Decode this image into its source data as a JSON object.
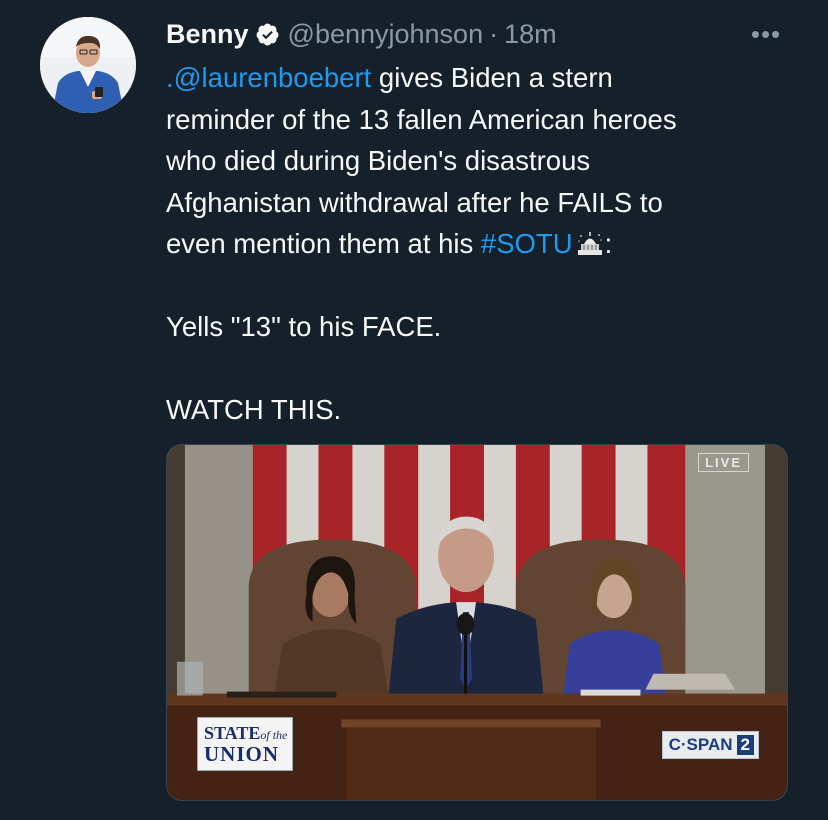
{
  "author": {
    "display_name": "Benny",
    "handle": "@bennyjohnson",
    "separator": "·",
    "timestamp": "18m",
    "verified": true
  },
  "more_menu_label": "•••",
  "tweet": {
    "mention": ".@laurenboebert",
    "line1_rest": " gives Biden a stern",
    "line2": "reminder of the 13 fallen American heroes",
    "line3": "who died during Biden's disastrous",
    "line4": "Afghanistan withdrawal after he FAILS to",
    "line5_start": "even mention them at his ",
    "hashtag": "#SOTU",
    "line5_end": ":",
    "line6": "Yells \"13\" to his FACE.",
    "line7": "WATCH THIS."
  },
  "media": {
    "live_label": "LIVE",
    "sotu_line1": "STATE",
    "sotu_of_the": "of the",
    "sotu_line2": "UNION",
    "network": "C·SPAN",
    "network_num": "2"
  },
  "colors": {
    "background": "#15202b",
    "link": "#1d9bf0",
    "verified_badge": "#f7f9f9",
    "secondary_text": "#8b98a5"
  }
}
